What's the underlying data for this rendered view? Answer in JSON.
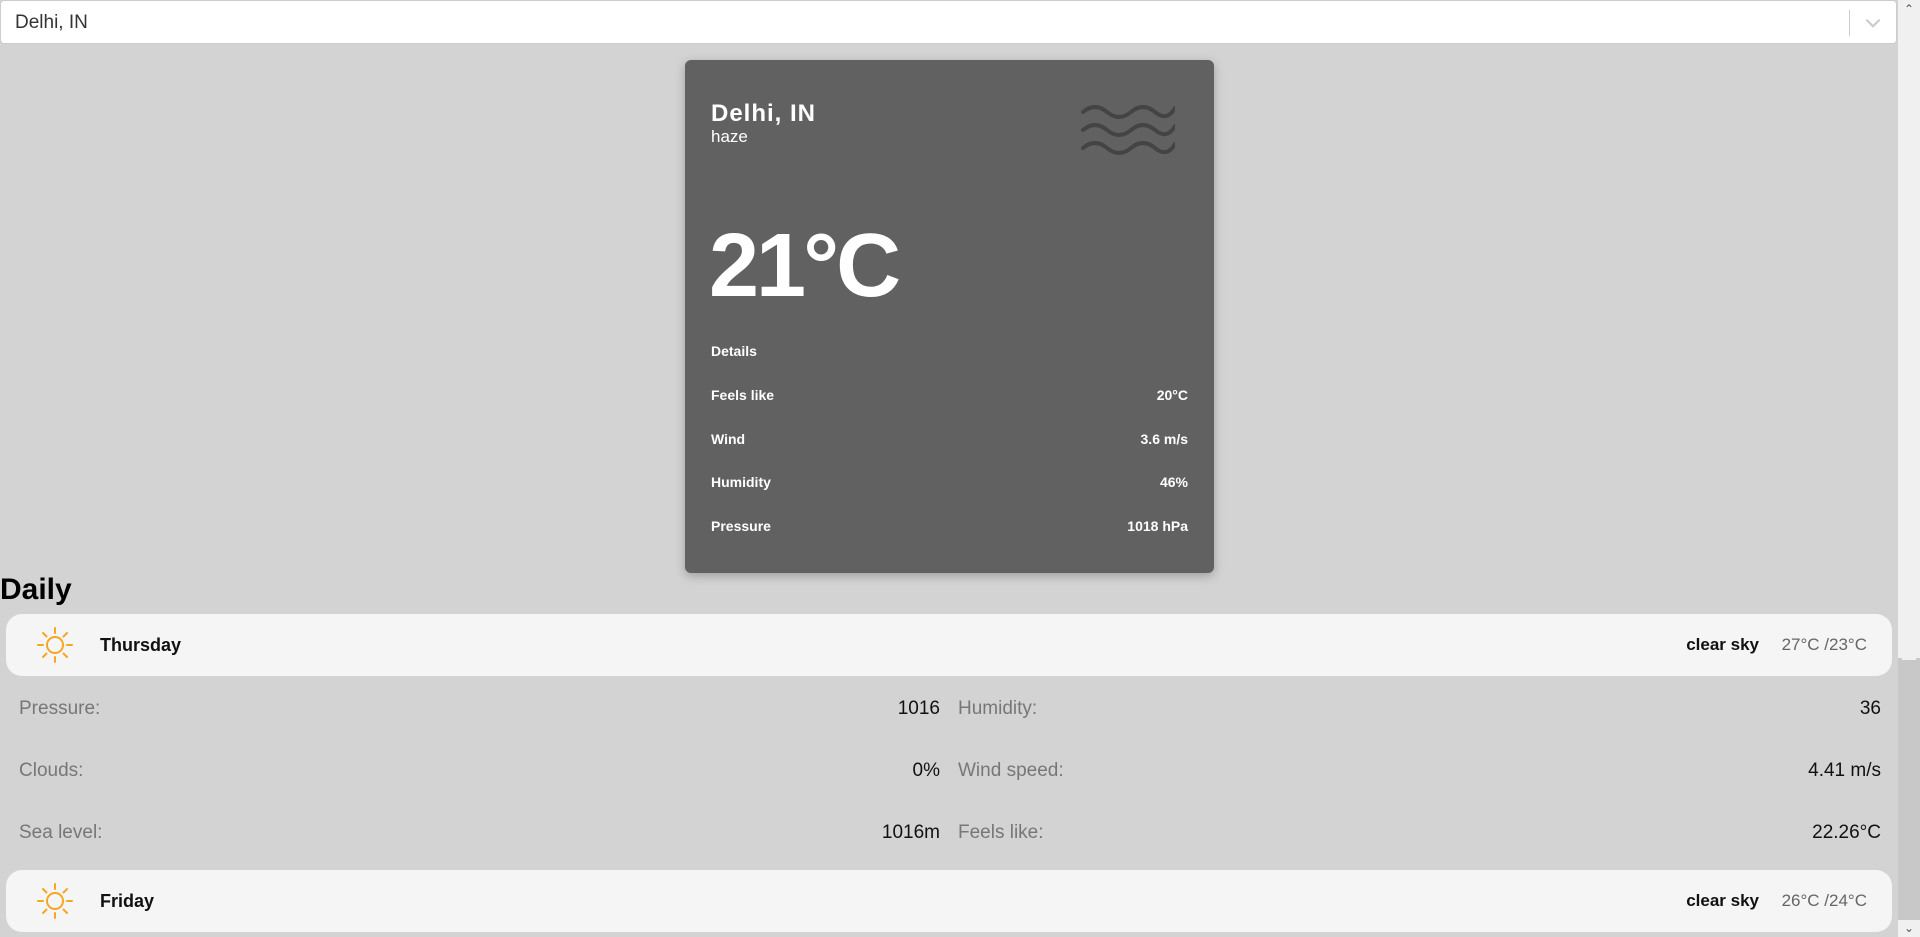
{
  "search": {
    "value": "Delhi, IN"
  },
  "current": {
    "city": "Delhi, IN",
    "description": "haze",
    "icon": "haze-icon",
    "temperature": "21°C",
    "details_title": "Details",
    "details": [
      {
        "label": "Feels like",
        "value": "20°C"
      },
      {
        "label": "Wind",
        "value": "3.6 m/s"
      },
      {
        "label": "Humidity",
        "value": "46%"
      },
      {
        "label": "Pressure",
        "value": "1018 hPa"
      }
    ]
  },
  "daily": {
    "title": "Daily",
    "days": [
      {
        "name": "Thursday",
        "icon": "sun-icon",
        "description": "clear sky",
        "minmax": "27°C /23°C",
        "details": {
          "pressure_label": "Pressure:",
          "pressure_value": "1016",
          "humidity_label": "Humidity:",
          "humidity_value": "36",
          "clouds_label": "Clouds:",
          "clouds_value": "0%",
          "wind_label": "Wind speed:",
          "wind_value": "4.41 m/s",
          "sea_label": "Sea level:",
          "sea_value": "1016m",
          "feels_label": "Feels like:",
          "feels_value": "22.26°C"
        }
      },
      {
        "name": "Friday",
        "icon": "sun-icon",
        "description": "clear sky",
        "minmax": "26°C /24°C"
      }
    ]
  },
  "colors": {
    "page_background": "#d3d3d3",
    "card_background": "#616161",
    "row_background": "#f5f5f5",
    "sun_color": "#f5a623"
  }
}
